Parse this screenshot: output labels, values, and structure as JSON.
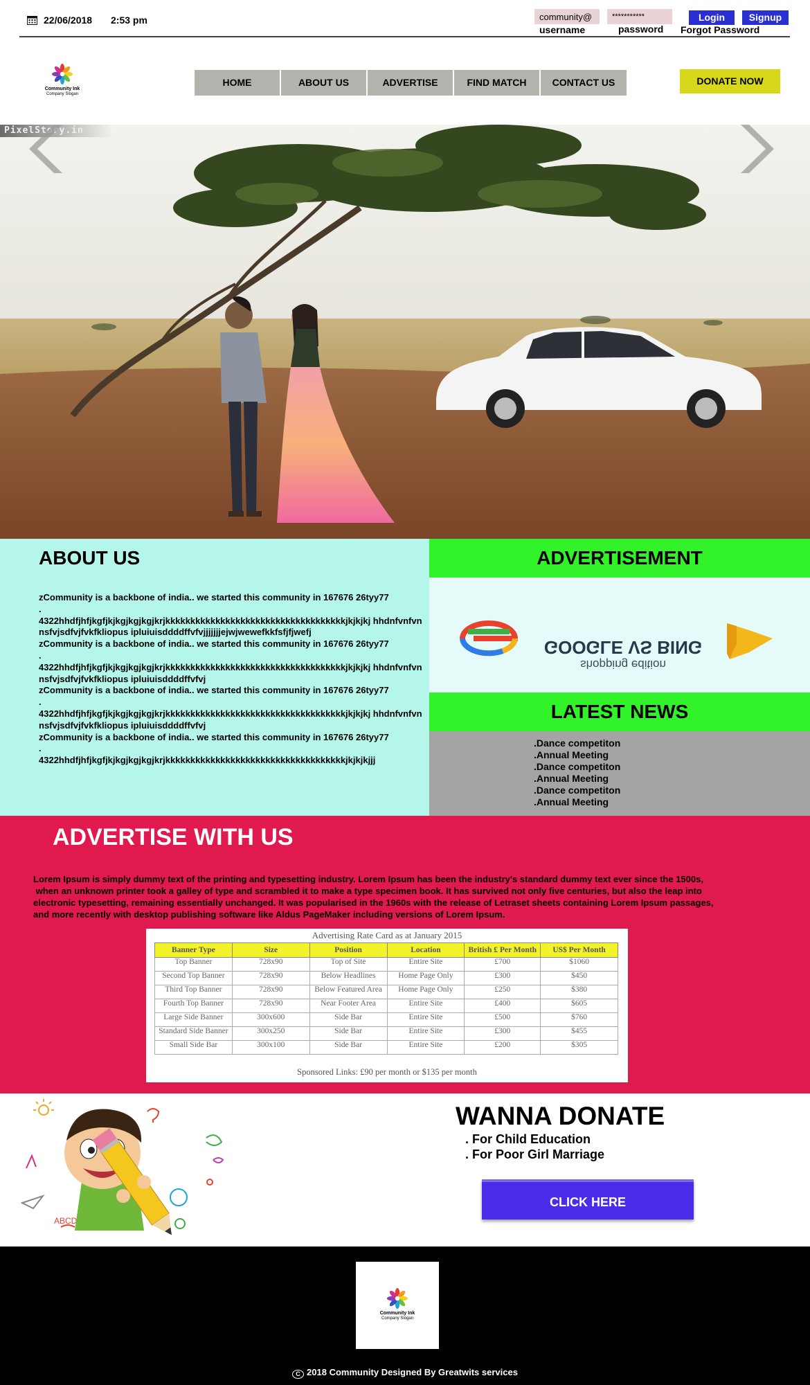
{
  "topbar": {
    "date": "22/06/2018",
    "time": "2:53 pm",
    "username_value": "community@",
    "username_label": "username",
    "password_value": "***********",
    "password_label": "password",
    "login": "Login",
    "signup": "Signup",
    "forgot": "Forgot Password"
  },
  "logo": {
    "name": "Community Ink",
    "slogan": "Company Slogan"
  },
  "nav": [
    "HOME",
    "ABOUT US",
    "ADVERTISE",
    "FIND MATCH",
    "CONTACT US"
  ],
  "donate_now": "DONATE NOW",
  "hero": {
    "watermark": "PixelStory.in"
  },
  "about": {
    "title": "ABOUT US",
    "body": "zCommunity is a backbone of india.. we started this community in 167676 26tyy77\n.\n4322hhdfjhfjkgfjkjkgjkgjkgjkrjkkkkkkkkkkkkkkkkkkkkkkkkkkkkkkkkkkkkjkjkjkj hhdnfvnfvnnsfvjsdfvjfvkfkliopus ipluiuisddddffvfvjjjjjjjejwjwewefkkfsfjfjwefj\nzCommunity is a backbone of india.. we started this community in 167676 26tyy77\n.\n4322hhdfjhfjkgfjkjkgjkgjkgjkrjkkkkkkkkkkkkkkkkkkkkkkkkkkkkkkkkkkkkjkjkjkj hhdnfvnfvnnsfvjsdfvjfvkfkliopus ipluiuisddddffvfvj\nzCommunity is a backbone of india.. we started this community in 167676 26tyy77\n.\n4322hhdfjhfjkgfjkjkgjkgjkgjkrjkkkkkkkkkkkkkkkkkkkkkkkkkkkkkkkkkkkkjkjkjkj hhdnfvnfvnnsfvjsdfvjfvkfkliopus ipluiuisddddffvfvj\nzCommunity is a backbone of india.. we started this community in 167676 26tyy77\n.\n4322hhdfjhfjkgfjkjkgjkgjkgjkrjkkkkkkkkkkkkkkkkkkkkkkkkkkkkkkkkkkkkjkjkjkjjj"
  },
  "advertisement": {
    "title": "ADVERTISEMENT",
    "banner_headline": "GOOGLE VS BING",
    "banner_subline": "shopping edition"
  },
  "news": {
    "title": "LATEST NEWS",
    "items": [
      ".Dance competiton",
      ".Annual Meeting",
      ".Dance competiton",
      ".Annual Meeting",
      ".Dance competiton",
      ".Annual Meeting"
    ]
  },
  "advertise": {
    "title": "ADVERTISE WITH US",
    "body": "Lorem Ipsum is simply dummy text of the printing and typesetting industry. Lorem Ipsum has been the industry's standard dummy text ever since the 1500s,\n when an unknown printer took a galley of type and scrambled it to make a type specimen book. It has survived not only five centuries, but also the leap into\nelectronic typesetting, remaining essentially unchanged. It was popularised in the 1960s with the release of Letraset sheets containing Lorem Ipsum passages,\nand more recently with desktop publishing software like Aldus PageMaker including versions of Lorem Ipsum.",
    "rate_card": {
      "title": "Advertising Rate Card as at January 2015",
      "headers": [
        "Banner Type",
        "Size",
        "Position",
        "Location",
        "British £ Per Month",
        "US$ Per Month"
      ],
      "rows": [
        [
          "Top Banner",
          "728x90",
          "Top of Site",
          "Entire Site",
          "£700",
          "$1060"
        ],
        [
          "Second Top Banner",
          "728x90",
          "Below Headlines",
          "Home Page Only",
          "£300",
          "$450"
        ],
        [
          "Third Top Banner",
          "728x90",
          "Below Featured Area",
          "Home Page Only",
          "£250",
          "$380"
        ],
        [
          "Fourth Top Banner",
          "728x90",
          "Near Footer Area",
          "Entire Site",
          "£400",
          "$605"
        ],
        [
          "Large Side Banner",
          "300x600",
          "Side Bar",
          "Entire Site",
          "£500",
          "$760"
        ],
        [
          "Standard Side Banner",
          "300x250",
          "Side Bar",
          "Entire Site",
          "£300",
          "$455"
        ],
        [
          "Small Side Bar",
          "300x100",
          "Side Bar",
          "Entire Site",
          "£200",
          "$305"
        ]
      ],
      "footer": "Sponsored Links: £90 per month or $135 per month"
    }
  },
  "donate": {
    "title": "WANNA DONATE",
    "reasons": [
      ". For Child Education",
      ". For Poor Girl Marriage"
    ],
    "button": "CLICK HERE"
  },
  "footer": {
    "copyright": "2018 Community Designed  By Greatwits services"
  },
  "colors": {
    "nav_bg": "#b3b3ad",
    "donate_now_bg": "#d8d81a",
    "login_blue": "#2a2fd3",
    "about_bg": "#b4f6ea",
    "green_header": "#32f22a",
    "news_bg": "#a4a4a4",
    "advertise_bg": "#e0194e",
    "click_here_bg": "#4a2bea",
    "footer_bg": "#000000"
  },
  "icons": [
    "calendar-icon",
    "prev-arrow-icon",
    "next-arrow-icon",
    "copyright-icon",
    "logo-icon"
  ]
}
